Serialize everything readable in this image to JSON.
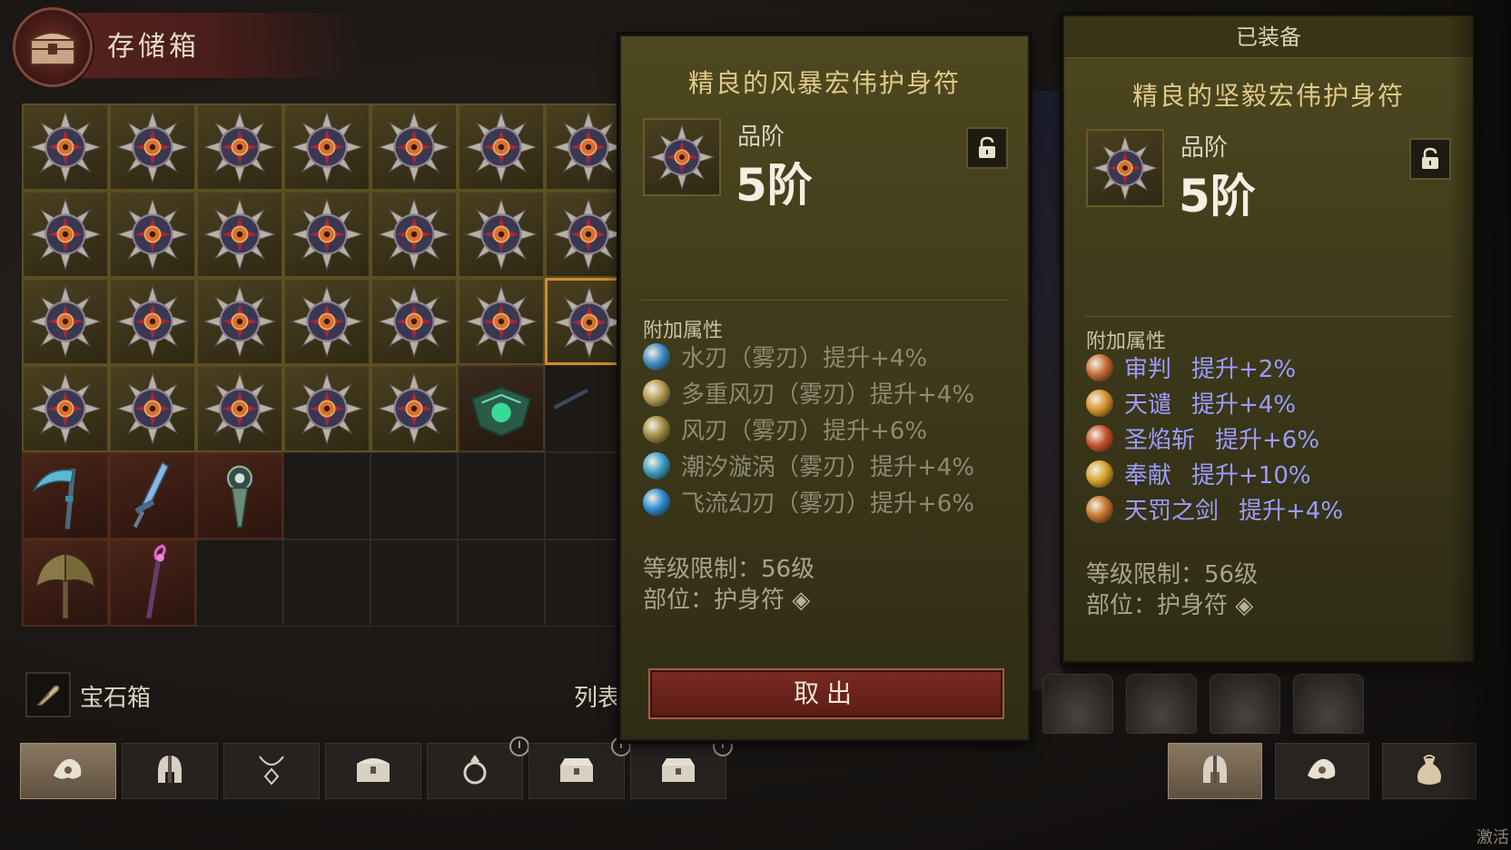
{
  "header": {
    "title": "存储箱",
    "icon": "chest-icon"
  },
  "storage": {
    "rows": [
      [
        "amulet",
        "amulet",
        "amulet",
        "amulet",
        "amulet",
        "amulet",
        "amulet"
      ],
      [
        "amulet",
        "amulet",
        "amulet",
        "amulet",
        "amulet",
        "amulet",
        "amulet"
      ],
      [
        "amulet",
        "amulet",
        "amulet",
        "amulet",
        "amulet",
        "amulet",
        "amulet-selected"
      ],
      [
        "amulet",
        "amulet",
        "amulet",
        "amulet",
        "amulet",
        "green-shield",
        "dark-item"
      ],
      [
        "scythe",
        "dagger",
        "pendant",
        "empty",
        "empty",
        "empty",
        "empty"
      ],
      [
        "axe",
        "staff",
        "empty",
        "empty",
        "empty",
        "empty",
        "empty"
      ]
    ]
  },
  "gem_box": {
    "label": "宝石箱",
    "icon": "feather-icon"
  },
  "list_label": "列表",
  "bottom_tabs": [
    {
      "icon": "amulet-tab-icon",
      "active": true
    },
    {
      "icon": "helmet-tab-icon",
      "active": false
    },
    {
      "icon": "necklace-tab-icon",
      "active": false
    },
    {
      "icon": "chest-tab-icon",
      "active": false
    },
    {
      "icon": "ring-tab-icon",
      "active": false,
      "timer": true
    },
    {
      "icon": "crate-tab-icon",
      "active": false,
      "timer": true
    },
    {
      "icon": "crate-tab-icon",
      "active": false,
      "timer": true
    }
  ],
  "selected_item": {
    "name": "精良的风暴宏伟护身符",
    "grade_label": "品阶",
    "grade_value": "5阶",
    "attributes_title": "附加属性",
    "attributes": [
      {
        "skill": "水刃（雾刃）",
        "bonus": "提升+4%",
        "gem_color": "#3a8ac4"
      },
      {
        "skill": "多重风刃（雾刃）",
        "bonus": "提升+4%",
        "gem_color": "#b09a50"
      },
      {
        "skill": "风刃（雾刃）",
        "bonus": "提升+6%",
        "gem_color": "#a08a40"
      },
      {
        "skill": "潮汐漩涡（雾刃）",
        "bonus": "提升+4%",
        "gem_color": "#3a9ac4"
      },
      {
        "skill": "飞流幻刃（雾刃）",
        "bonus": "提升+6%",
        "gem_color": "#2a8ad4"
      }
    ],
    "level_req": "等级限制：56级",
    "slot": "部位：护身符",
    "take_out": "取出"
  },
  "equipped_item": {
    "header": "已装备",
    "name": "精良的坚毅宏伟护身符",
    "grade_label": "品阶",
    "grade_value": "5阶",
    "attributes_title": "附加属性",
    "attributes": [
      {
        "skill": "审判",
        "bonus": "提升+2%",
        "gem_color": "#c46a30"
      },
      {
        "skill": "天谴",
        "bonus": "提升+4%",
        "gem_color": "#d8902a"
      },
      {
        "skill": "圣焰斩",
        "bonus": "提升+6%",
        "gem_color": "#c4502a"
      },
      {
        "skill": "奉献",
        "bonus": "提升+10%",
        "gem_color": "#d8a02a"
      },
      {
        "skill": "天罚之剑",
        "bonus": "提升+4%",
        "gem_color": "#c4702a"
      }
    ],
    "level_req": "等级限制：56级",
    "slot": "部位：护身符"
  },
  "side_tabs": [
    {
      "icon": "helmet-tab-icon",
      "active": true
    },
    {
      "icon": "amulet-tab-icon",
      "active": false
    },
    {
      "icon": "pouch-tab-icon",
      "active": false
    }
  ],
  "watermark": "激活"
}
